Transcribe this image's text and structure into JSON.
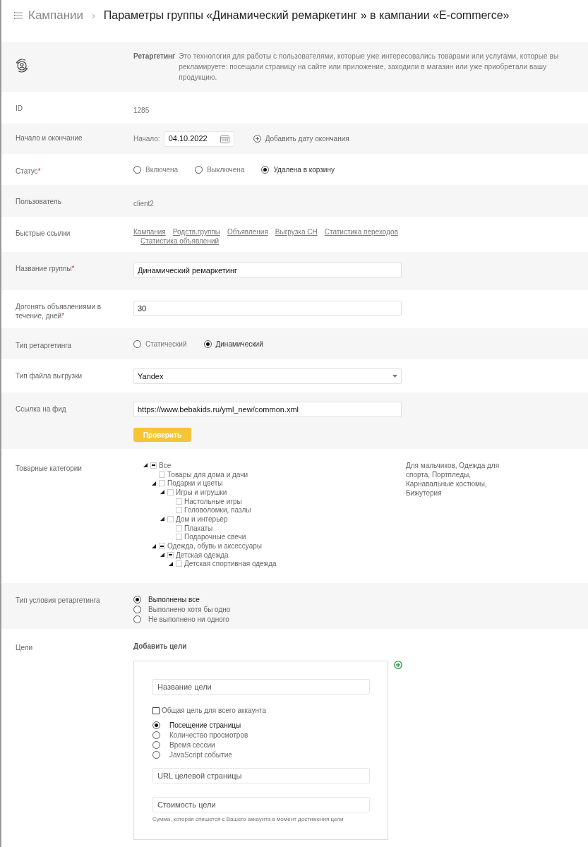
{
  "breadcrumb": {
    "parent": "Кампании",
    "separator": "›",
    "title": "Параметры группы «Динамический ремаркетинг » в кампании «E-commerce»"
  },
  "info": {
    "title": "Ретаргетинг",
    "text": "Это технология для работы с пользователями, которые уже интересовались товарами или услугами, которые вы рекламируете: посещали страницу на сайте или приложение, заходили в магазин или уже приобретали вашу продукцию."
  },
  "rows": [
    {
      "kind": "text",
      "label": "ID",
      "value": "1285"
    },
    {
      "kind": "dates",
      "label": "Начало и окончание",
      "start_label": "Начало:",
      "start_value": "04.10.2022",
      "add_end": "Добавить дату окончания"
    },
    {
      "kind": "radios",
      "label": "Статус",
      "required_mark": "*",
      "options": [
        {
          "label": "Включена",
          "selected": false
        },
        {
          "label": "Выключена",
          "selected": false
        },
        {
          "label": "Удалена в корзину",
          "selected": true
        }
      ]
    },
    {
      "kind": "text",
      "label": "Пользователь",
      "value": "client2"
    },
    {
      "kind": "links",
      "label": "Быстрые ссылки",
      "links": [
        "Кампания",
        "Родств.группы",
        "Объявления",
        "Выгрузка СН",
        "Статистика переходов",
        "Статистика объявлений"
      ]
    },
    {
      "kind": "input",
      "label": "Название группы",
      "required_mark": "*",
      "value": "Динамический ремаркетинг"
    },
    {
      "kind": "input",
      "label": "Догонять объявлениями в течение, дней",
      "required_mark": "*",
      "value": "30"
    },
    {
      "kind": "radios",
      "label": "Тип ретаргетинга",
      "options": [
        {
          "label": "Статический",
          "selected": false
        },
        {
          "label": "Динамический",
          "selected": true
        }
      ]
    },
    {
      "kind": "select",
      "label": "Тип файла выгрузки",
      "value": "Yandex"
    },
    {
      "kind": "feed",
      "label": "Ссылка на фид",
      "value": "https://www.bebakids.ru/yml_new/common.xml",
      "button": "Проверить"
    },
    {
      "kind": "tree",
      "label": "Товарные категории",
      "summary": "Для мальчиков, Одежда для спорта, Портпледы, Карнавальные костюмы, Бижутерия",
      "tree": [
        {
          "label": "Все",
          "partial": true,
          "expanded": true,
          "children": [
            {
              "label": "Товары для дома и дачи",
              "partial": false
            },
            {
              "label": "Подарки и цветы",
              "partial": false,
              "expanded": true,
              "children": [
                {
                  "label": "Игры и игрушки",
                  "partial": false,
                  "expanded": true,
                  "children": [
                    {
                      "label": "Настольные игры",
                      "partial": false
                    },
                    {
                      "label": "Головоломки, пазлы",
                      "partial": false
                    }
                  ]
                },
                {
                  "label": "Дом и интерьер",
                  "partial": false,
                  "expanded": true,
                  "children": [
                    {
                      "label": "Плакаты",
                      "partial": false
                    },
                    {
                      "label": "Подарочные свечи",
                      "partial": false
                    }
                  ]
                }
              ]
            },
            {
              "label": "Одежда, обувь и аксессуары",
              "partial": true,
              "expanded": true,
              "children": [
                {
                  "label": "Детская одежда",
                  "partial": true,
                  "expanded": true,
                  "children": [
                    {
                      "label": "Детская спортивная одежда",
                      "partial": false,
                      "expanded": true
                    }
                  ]
                }
              ]
            }
          ]
        }
      ]
    },
    {
      "kind": "radio_list",
      "label": "Тип условия ретаргетинга",
      "options": [
        {
          "label": "Выполнены все",
          "selected": true
        },
        {
          "label": "Выполнено хотя бы одно",
          "selected": false
        },
        {
          "label": "Не выполнено ни одного",
          "selected": false
        }
      ]
    },
    {
      "kind": "goals",
      "label": "Цели",
      "heading": "Добавить цели",
      "name_placeholder": "Название цели",
      "shared": {
        "label": "Общая цель для всего аккаунта",
        "checked": false
      },
      "types": [
        {
          "label": "Посещение страницы",
          "selected": true
        },
        {
          "label": "Количество просмотров",
          "selected": false
        },
        {
          "label": "Время сессии",
          "selected": false
        },
        {
          "label": "JavaScript событие",
          "selected": false
        }
      ],
      "url_placeholder": "URL целевой страницы",
      "cost_placeholder": "Стоимость цели",
      "hint": "Сумма, которая спишется с Вашего аккаунта в момент достижения цели"
    }
  ]
}
